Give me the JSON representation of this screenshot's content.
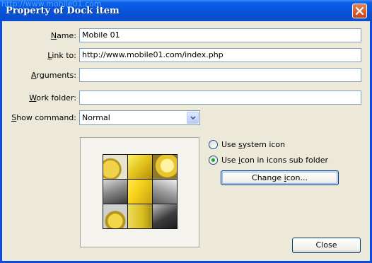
{
  "watermark": "http://www.mobile01.com",
  "window": {
    "title": "Property of Dock item"
  },
  "fields": {
    "name": {
      "label_u": "N",
      "label_rest": "ame:",
      "value": "Mobile 01"
    },
    "link_to": {
      "label_u": "L",
      "label_rest": "ink to:",
      "value": "http://www.mobile01.com/index.php"
    },
    "arguments": {
      "label_u": "A",
      "label_rest": "rguments:",
      "value": ""
    },
    "work_folder": {
      "label_u": "W",
      "label_rest": "ork folder:",
      "value": ""
    },
    "show_command": {
      "label_u": "S",
      "label_rest": "how command:",
      "value": "Normal"
    }
  },
  "icon_options": {
    "system": {
      "label_pre": "Use ",
      "label_u": "s",
      "label_post": "ystem icon",
      "selected": false
    },
    "subfolder": {
      "label_pre": "Use ",
      "label_u": "i",
      "label_post": "con in icons sub folder",
      "selected": true
    }
  },
  "buttons": {
    "change_icon": {
      "label_pre": "Change ",
      "label_u": "i",
      "label_post": "con..."
    },
    "close": {
      "label": "Close"
    }
  },
  "colors": {
    "titlebar": "#0753d8",
    "dialog_bg": "#ece9d8",
    "field_border": "#7f9db9",
    "radio_dot": "#21a121"
  }
}
